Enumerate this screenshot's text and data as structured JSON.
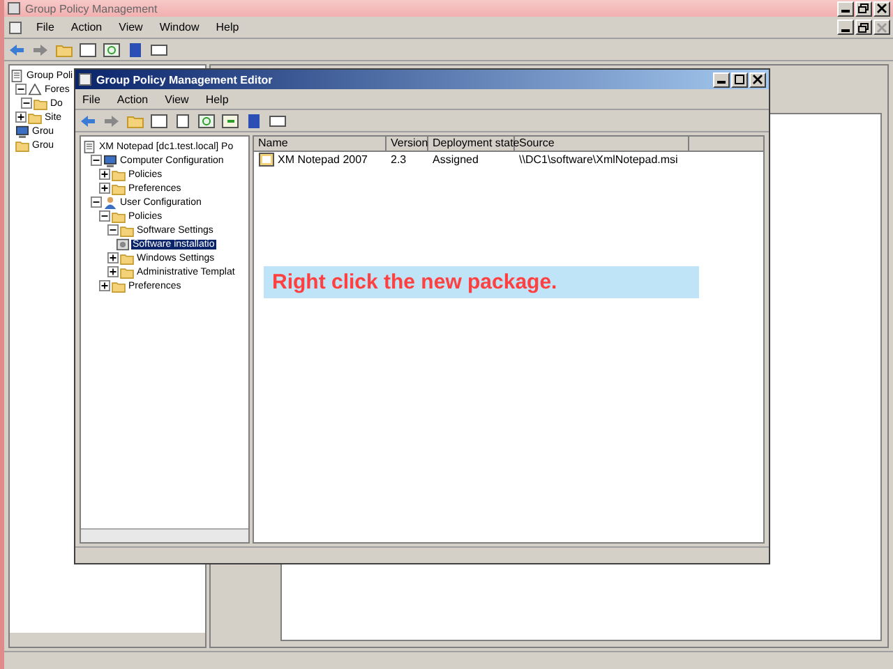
{
  "main_window": {
    "title": "Group Policy Management",
    "menu": [
      "File",
      "Action",
      "View",
      "Window",
      "Help"
    ],
    "tree": [
      {
        "label": "Group Poli",
        "kind": "policy",
        "children": [
          {
            "label": "Fores",
            "expanded": true,
            "kind": "forest",
            "children": [
              {
                "label": "Do",
                "expanded": true,
                "kind": "folder"
              }
            ]
          },
          {
            "label": "Site",
            "expanded": false,
            "kind": "folder"
          },
          {
            "label": "Grou",
            "kind": "computer"
          },
          {
            "label": "Grou",
            "kind": "folder"
          }
        ]
      }
    ]
  },
  "editor_window": {
    "title": "Group Policy Management Editor",
    "menu": [
      "File",
      "Action",
      "View",
      "Help"
    ],
    "tree": [
      {
        "label": "XM Notepad [dc1.test.local] Po",
        "kind": "policy",
        "selected": false,
        "children": [
          {
            "label": "Computer Configuration",
            "expanded": true,
            "kind": "computer",
            "selected": false,
            "children": [
              {
                "label": "Policies",
                "expanded": false,
                "kind": "folder",
                "selected": false
              },
              {
                "label": "Preferences",
                "expanded": false,
                "kind": "folder",
                "selected": false
              }
            ]
          },
          {
            "label": "User Configuration",
            "expanded": true,
            "kind": "user",
            "selected": false,
            "children": [
              {
                "label": "Policies",
                "expanded": true,
                "kind": "folder",
                "selected": false,
                "children": [
                  {
                    "label": "Software Settings",
                    "expanded": true,
                    "kind": "folder",
                    "selected": false,
                    "children": [
                      {
                        "label": "Software installatio",
                        "kind": "install",
                        "selected": true
                      }
                    ]
                  },
                  {
                    "label": "Windows Settings",
                    "expanded": false,
                    "kind": "folder",
                    "selected": false
                  },
                  {
                    "label": "Administrative Templat",
                    "expanded": false,
                    "kind": "folder",
                    "selected": false
                  }
                ]
              },
              {
                "label": "Preferences",
                "expanded": false,
                "kind": "folder",
                "selected": false
              }
            ]
          }
        ]
      }
    ],
    "columns": [
      "Name",
      "Version",
      "Deployment state",
      "Source"
    ],
    "rows": [
      {
        "cells": [
          "XM Notepad 2007",
          "2.3",
          "Assigned",
          "\\\\DC1\\software\\XmlNotepad.msi"
        ],
        "selected": false
      }
    ]
  },
  "callout": {
    "text": "Right click the new package."
  }
}
